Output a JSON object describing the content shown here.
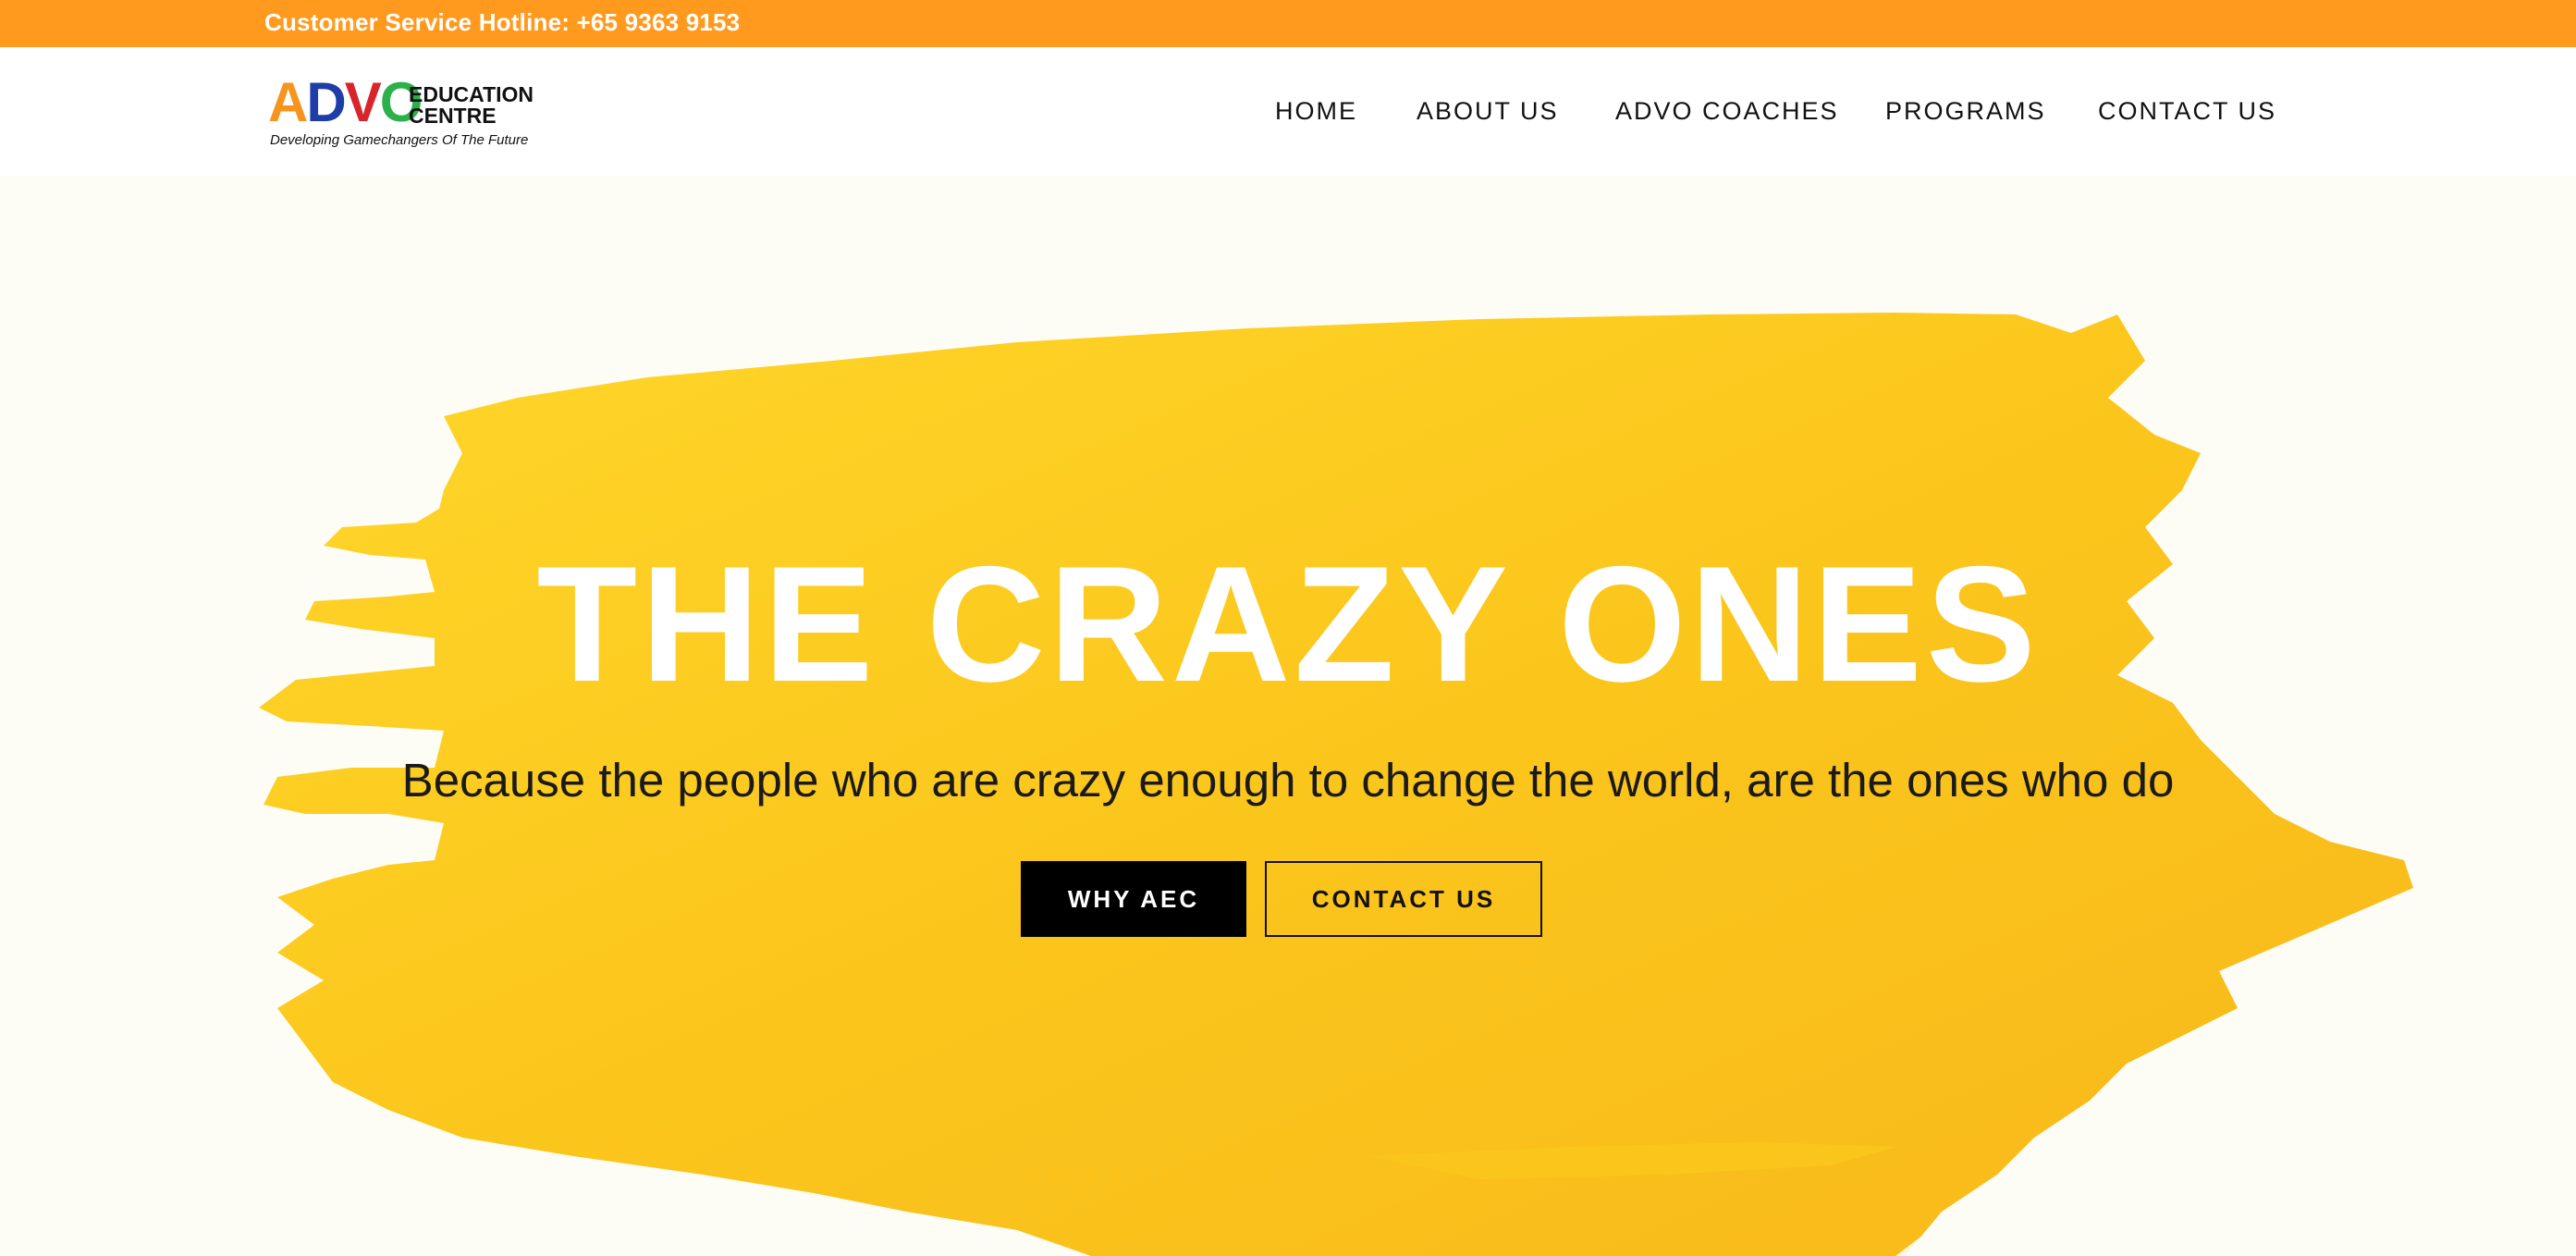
{
  "topbar": {
    "hotline": "Customer Service Hotline: +65 9363 9153",
    "background": "#ff9a1f"
  },
  "logo": {
    "letters": [
      "A",
      "D",
      "V",
      "O"
    ],
    "education": "EDUCATION",
    "centre": "CENTRE",
    "tagline": "Developing Gamechangers Of The Future",
    "colors": [
      "#f7941d",
      "#1f3da8",
      "#d7262b",
      "#2cb04a"
    ]
  },
  "nav": {
    "items": [
      "HOME",
      "ABOUT US",
      "ADVO COACHES",
      "PROGRAMS",
      "CONTACT US"
    ]
  },
  "hero": {
    "headline": "THE CRAZY ONES",
    "subline": "Because the people who are crazy enough to change the world, are the ones who do",
    "primary_button": "WHY AEC",
    "secondary_button": "CONTACT US",
    "paint_color": "#fbcd1f"
  }
}
